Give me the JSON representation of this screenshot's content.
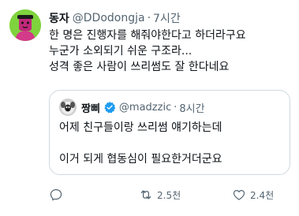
{
  "tweet": {
    "display_name": "동자",
    "handle": "@DDodongja",
    "separator": "·",
    "time": "7시간",
    "text_lines": [
      "한 명은 진행자를 해줘야한다고 하더라구요",
      "누군가 소외되기 쉬운 구조라...",
      "성격 좋은 사람이 쓰리썸도 잘 한다네요"
    ],
    "avatar_icon": "green-character-avatar-icon"
  },
  "quote": {
    "display_name": "짱삐",
    "handle": "@madzzic",
    "separator": "·",
    "time": "8시간",
    "verified_icon": "verified-badge-icon",
    "text_lines": [
      "어제 친구들이랑 쓰리썸 얘기하는데",
      "",
      "이거 되게 협동심이 필요한거더군요"
    ],
    "avatar_icon": "dog-photo-avatar-icon"
  },
  "actions": {
    "reply_icon": "reply-icon",
    "retweet_icon": "retweet-icon",
    "retweet_count": "2.5천",
    "like_icon": "heart-icon",
    "like_count": "2.4천"
  },
  "colors": {
    "text_primary": "#0f1419",
    "text_secondary": "#536471",
    "border": "#cfd9de",
    "verified": "#1d9bf0",
    "avatar_bg": "#7fd33d"
  }
}
